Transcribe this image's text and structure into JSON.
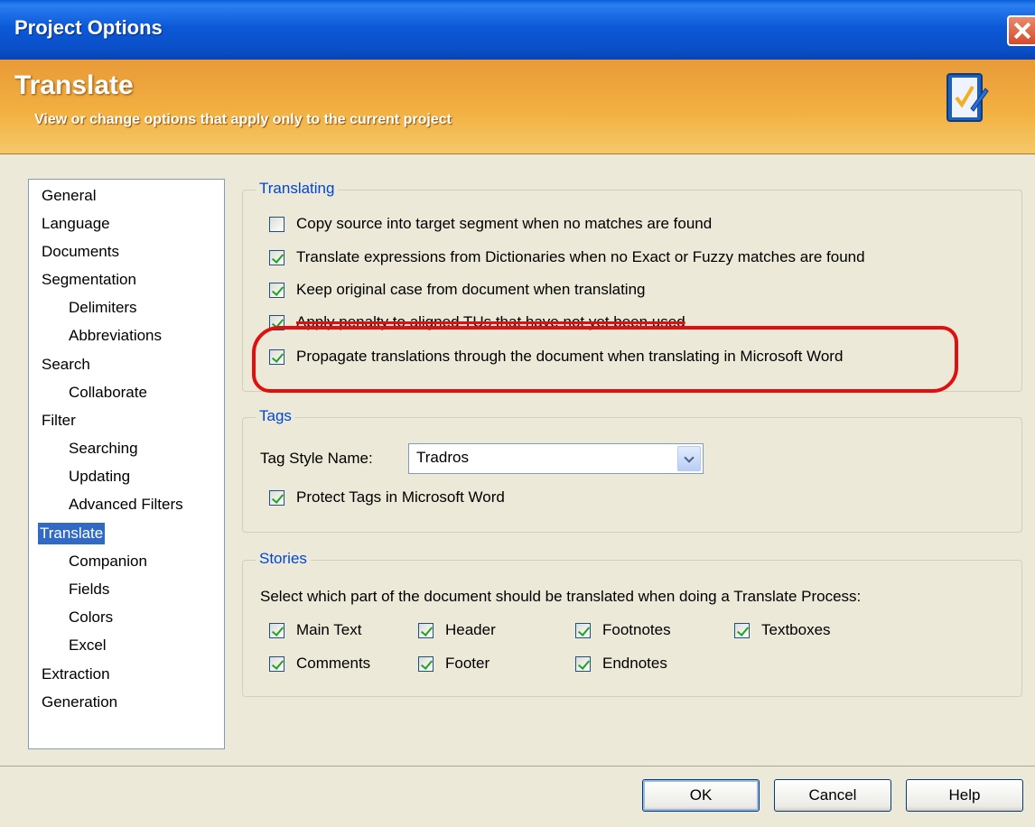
{
  "window": {
    "title": "Project Options"
  },
  "banner": {
    "title": "Translate",
    "subtitle": "View or change options that apply only to the current project",
    "icon": "checklist-pen-icon"
  },
  "nav": {
    "items": [
      {
        "label": "General",
        "level": 0
      },
      {
        "label": "Language",
        "level": 0
      },
      {
        "label": "Documents",
        "level": 0
      },
      {
        "label": "Segmentation",
        "level": 0
      },
      {
        "label": "Delimiters",
        "level": 1
      },
      {
        "label": "Abbreviations",
        "level": 1
      },
      {
        "label": "Search",
        "level": 0
      },
      {
        "label": "Collaborate",
        "level": 1
      },
      {
        "label": "Filter",
        "level": 0
      },
      {
        "label": "Searching",
        "level": 1
      },
      {
        "label": "Updating",
        "level": 1
      },
      {
        "label": "Advanced Filters",
        "level": 1
      },
      {
        "label": "Translate",
        "level": 0,
        "selected": true
      },
      {
        "label": "Companion",
        "level": 1
      },
      {
        "label": "Fields",
        "level": 1
      },
      {
        "label": "Colors",
        "level": 1
      },
      {
        "label": "Excel",
        "level": 1
      },
      {
        "label": "Extraction",
        "level": 0
      },
      {
        "label": "Generation",
        "level": 0
      }
    ]
  },
  "translating": {
    "legend": "Translating",
    "options": [
      {
        "label": "Copy source into target segment when no matches are found",
        "checked": false
      },
      {
        "label": "Translate expressions from Dictionaries when no Exact or Fuzzy matches are found",
        "checked": true
      },
      {
        "label": "Keep original case from document when translating",
        "checked": true
      },
      {
        "label": "Apply penalty to aligned TUs that have not yet been used",
        "checked": true
      },
      {
        "label": "Propagate translations through the document when translating in Microsoft Word",
        "checked": true
      }
    ]
  },
  "tags": {
    "legend": "Tags",
    "style_label": "Tag Style Name:",
    "style_value": "Tradros",
    "protect_label": "Protect Tags in Microsoft Word",
    "protect_checked": true
  },
  "stories": {
    "legend": "Stories",
    "description": "Select which part of the document should be translated when doing a Translate Process:",
    "items": [
      {
        "label": "Main Text",
        "checked": true
      },
      {
        "label": "Header",
        "checked": true
      },
      {
        "label": "Footnotes",
        "checked": true
      },
      {
        "label": "Textboxes",
        "checked": true
      },
      {
        "label": "Comments",
        "checked": true
      },
      {
        "label": "Footer",
        "checked": true
      },
      {
        "label": "Endnotes",
        "checked": true
      }
    ]
  },
  "buttons": {
    "ok": "OK",
    "cancel": "Cancel",
    "help": "Help"
  },
  "colors": {
    "title_bar": "#0a4ec6",
    "banner": "#f2b040",
    "selection": "#316ac5",
    "highlight_ring": "#e01010",
    "legend_text": "#0046d5"
  }
}
